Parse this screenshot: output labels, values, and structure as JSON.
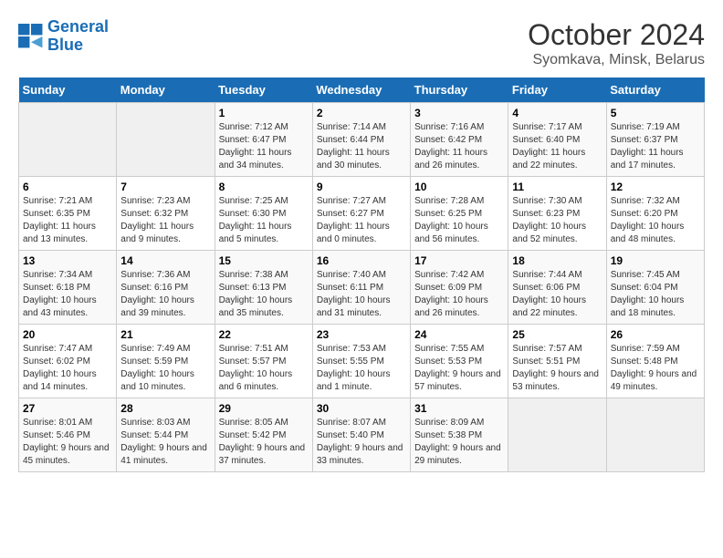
{
  "header": {
    "logo_line1": "General",
    "logo_line2": "Blue",
    "month_title": "October 2024",
    "location": "Syomkava, Minsk, Belarus"
  },
  "weekdays": [
    "Sunday",
    "Monday",
    "Tuesday",
    "Wednesday",
    "Thursday",
    "Friday",
    "Saturday"
  ],
  "weeks": [
    [
      {
        "num": "",
        "sunrise": "",
        "sunset": "",
        "daylight": ""
      },
      {
        "num": "",
        "sunrise": "",
        "sunset": "",
        "daylight": ""
      },
      {
        "num": "1",
        "sunrise": "Sunrise: 7:12 AM",
        "sunset": "Sunset: 6:47 PM",
        "daylight": "Daylight: 11 hours and 34 minutes."
      },
      {
        "num": "2",
        "sunrise": "Sunrise: 7:14 AM",
        "sunset": "Sunset: 6:44 PM",
        "daylight": "Daylight: 11 hours and 30 minutes."
      },
      {
        "num": "3",
        "sunrise": "Sunrise: 7:16 AM",
        "sunset": "Sunset: 6:42 PM",
        "daylight": "Daylight: 11 hours and 26 minutes."
      },
      {
        "num": "4",
        "sunrise": "Sunrise: 7:17 AM",
        "sunset": "Sunset: 6:40 PM",
        "daylight": "Daylight: 11 hours and 22 minutes."
      },
      {
        "num": "5",
        "sunrise": "Sunrise: 7:19 AM",
        "sunset": "Sunset: 6:37 PM",
        "daylight": "Daylight: 11 hours and 17 minutes."
      }
    ],
    [
      {
        "num": "6",
        "sunrise": "Sunrise: 7:21 AM",
        "sunset": "Sunset: 6:35 PM",
        "daylight": "Daylight: 11 hours and 13 minutes."
      },
      {
        "num": "7",
        "sunrise": "Sunrise: 7:23 AM",
        "sunset": "Sunset: 6:32 PM",
        "daylight": "Daylight: 11 hours and 9 minutes."
      },
      {
        "num": "8",
        "sunrise": "Sunrise: 7:25 AM",
        "sunset": "Sunset: 6:30 PM",
        "daylight": "Daylight: 11 hours and 5 minutes."
      },
      {
        "num": "9",
        "sunrise": "Sunrise: 7:27 AM",
        "sunset": "Sunset: 6:27 PM",
        "daylight": "Daylight: 11 hours and 0 minutes."
      },
      {
        "num": "10",
        "sunrise": "Sunrise: 7:28 AM",
        "sunset": "Sunset: 6:25 PM",
        "daylight": "Daylight: 10 hours and 56 minutes."
      },
      {
        "num": "11",
        "sunrise": "Sunrise: 7:30 AM",
        "sunset": "Sunset: 6:23 PM",
        "daylight": "Daylight: 10 hours and 52 minutes."
      },
      {
        "num": "12",
        "sunrise": "Sunrise: 7:32 AM",
        "sunset": "Sunset: 6:20 PM",
        "daylight": "Daylight: 10 hours and 48 minutes."
      }
    ],
    [
      {
        "num": "13",
        "sunrise": "Sunrise: 7:34 AM",
        "sunset": "Sunset: 6:18 PM",
        "daylight": "Daylight: 10 hours and 43 minutes."
      },
      {
        "num": "14",
        "sunrise": "Sunrise: 7:36 AM",
        "sunset": "Sunset: 6:16 PM",
        "daylight": "Daylight: 10 hours and 39 minutes."
      },
      {
        "num": "15",
        "sunrise": "Sunrise: 7:38 AM",
        "sunset": "Sunset: 6:13 PM",
        "daylight": "Daylight: 10 hours and 35 minutes."
      },
      {
        "num": "16",
        "sunrise": "Sunrise: 7:40 AM",
        "sunset": "Sunset: 6:11 PM",
        "daylight": "Daylight: 10 hours and 31 minutes."
      },
      {
        "num": "17",
        "sunrise": "Sunrise: 7:42 AM",
        "sunset": "Sunset: 6:09 PM",
        "daylight": "Daylight: 10 hours and 26 minutes."
      },
      {
        "num": "18",
        "sunrise": "Sunrise: 7:44 AM",
        "sunset": "Sunset: 6:06 PM",
        "daylight": "Daylight: 10 hours and 22 minutes."
      },
      {
        "num": "19",
        "sunrise": "Sunrise: 7:45 AM",
        "sunset": "Sunset: 6:04 PM",
        "daylight": "Daylight: 10 hours and 18 minutes."
      }
    ],
    [
      {
        "num": "20",
        "sunrise": "Sunrise: 7:47 AM",
        "sunset": "Sunset: 6:02 PM",
        "daylight": "Daylight: 10 hours and 14 minutes."
      },
      {
        "num": "21",
        "sunrise": "Sunrise: 7:49 AM",
        "sunset": "Sunset: 5:59 PM",
        "daylight": "Daylight: 10 hours and 10 minutes."
      },
      {
        "num": "22",
        "sunrise": "Sunrise: 7:51 AM",
        "sunset": "Sunset: 5:57 PM",
        "daylight": "Daylight: 10 hours and 6 minutes."
      },
      {
        "num": "23",
        "sunrise": "Sunrise: 7:53 AM",
        "sunset": "Sunset: 5:55 PM",
        "daylight": "Daylight: 10 hours and 1 minute."
      },
      {
        "num": "24",
        "sunrise": "Sunrise: 7:55 AM",
        "sunset": "Sunset: 5:53 PM",
        "daylight": "Daylight: 9 hours and 57 minutes."
      },
      {
        "num": "25",
        "sunrise": "Sunrise: 7:57 AM",
        "sunset": "Sunset: 5:51 PM",
        "daylight": "Daylight: 9 hours and 53 minutes."
      },
      {
        "num": "26",
        "sunrise": "Sunrise: 7:59 AM",
        "sunset": "Sunset: 5:48 PM",
        "daylight": "Daylight: 9 hours and 49 minutes."
      }
    ],
    [
      {
        "num": "27",
        "sunrise": "Sunrise: 8:01 AM",
        "sunset": "Sunset: 5:46 PM",
        "daylight": "Daylight: 9 hours and 45 minutes."
      },
      {
        "num": "28",
        "sunrise": "Sunrise: 8:03 AM",
        "sunset": "Sunset: 5:44 PM",
        "daylight": "Daylight: 9 hours and 41 minutes."
      },
      {
        "num": "29",
        "sunrise": "Sunrise: 8:05 AM",
        "sunset": "Sunset: 5:42 PM",
        "daylight": "Daylight: 9 hours and 37 minutes."
      },
      {
        "num": "30",
        "sunrise": "Sunrise: 8:07 AM",
        "sunset": "Sunset: 5:40 PM",
        "daylight": "Daylight: 9 hours and 33 minutes."
      },
      {
        "num": "31",
        "sunrise": "Sunrise: 8:09 AM",
        "sunset": "Sunset: 5:38 PM",
        "daylight": "Daylight: 9 hours and 29 minutes."
      },
      {
        "num": "",
        "sunrise": "",
        "sunset": "",
        "daylight": ""
      },
      {
        "num": "",
        "sunrise": "",
        "sunset": "",
        "daylight": ""
      }
    ]
  ]
}
